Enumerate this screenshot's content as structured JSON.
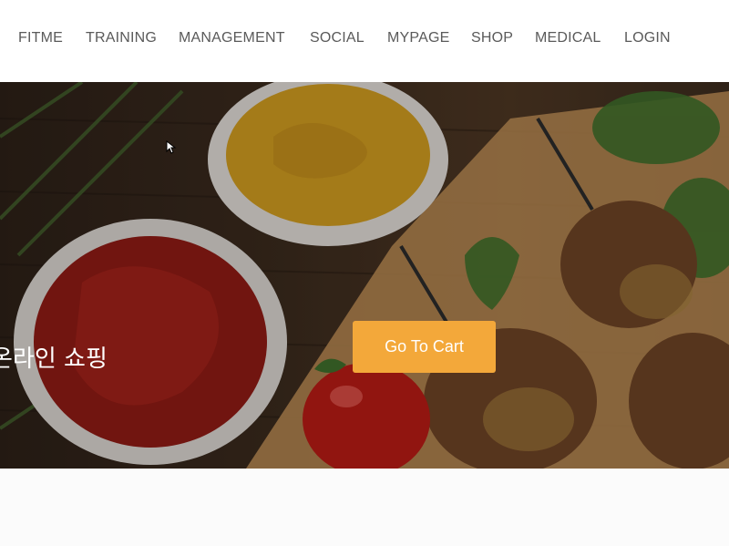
{
  "nav": {
    "items": [
      {
        "label": "FITME"
      },
      {
        "label": "TRAINING"
      },
      {
        "label": "MANAGEMENT"
      },
      {
        "label": "SOCIAL"
      },
      {
        "label": "MYPAGE"
      },
      {
        "label": "SHOP"
      },
      {
        "label": "MEDICAL"
      },
      {
        "label": "LOGIN"
      }
    ]
  },
  "hero": {
    "title": "온라인 쇼핑",
    "cta_label": "Go To Cart",
    "image_icon": "food-banner-image"
  },
  "colors": {
    "accent": "#f3a83a",
    "nav_text": "#5a5a5a",
    "background": "#ffffff"
  }
}
